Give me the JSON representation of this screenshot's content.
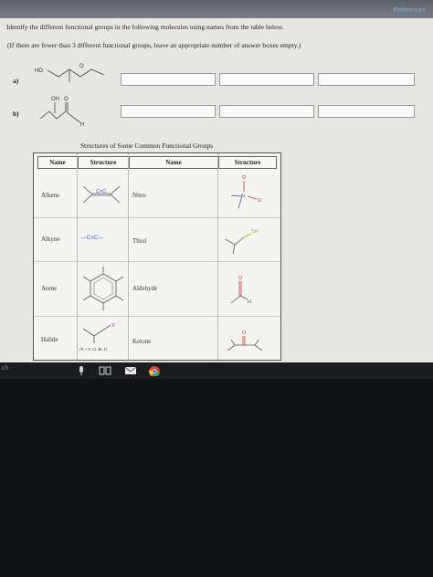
{
  "header": {
    "references_link": "References"
  },
  "question": {
    "instruction": "Identify the different functional groups in the following molecules using names from the table below.",
    "note": "(If there are fewer than 3 different functional groups, leave an appropriate number of answer boxes empty.)",
    "parts": [
      {
        "label": "a)",
        "atoms": [
          "HO",
          "O"
        ],
        "answers": [
          "",
          "",
          ""
        ]
      },
      {
        "label": "b)",
        "atoms": [
          "OH",
          "O",
          "H"
        ],
        "answers": [
          "",
          "",
          ""
        ]
      }
    ]
  },
  "table": {
    "title": "Structures of Some Common Functional Groups",
    "headers": [
      "Name",
      "Structure",
      "Name",
      "Structure"
    ],
    "rows": [
      {
        "left_name": "Alkene",
        "left_struct": "C=C",
        "right_name": "Nitro",
        "right_struct_atoms": [
          "O",
          "N",
          "O"
        ]
      },
      {
        "left_name": "Alkyne",
        "left_struct": "—C≡C—",
        "right_name": "Thiol",
        "right_struct_atoms": [
          "SH"
        ]
      },
      {
        "left_name": "Arene",
        "left_struct": "",
        "right_name": "Aldehyde",
        "right_struct_atoms": [
          "O",
          "H"
        ]
      },
      {
        "left_name": "Halide",
        "left_struct": "X",
        "left_sub": "(X = F, Cl, Br, I)",
        "right_name": "Ketone",
        "right_struct_atoms": [
          "O"
        ]
      }
    ]
  },
  "taskbar": {
    "left_text": "ch",
    "icons": [
      "microphone-icon",
      "task-view-icon",
      "mail-icon",
      "chrome-icon"
    ]
  },
  "colors": {
    "screen_bg": "#e6e7e3",
    "desk_bg": "#111214",
    "taskbar_bg": "#1a1c20",
    "link": "#8fa4c8"
  }
}
